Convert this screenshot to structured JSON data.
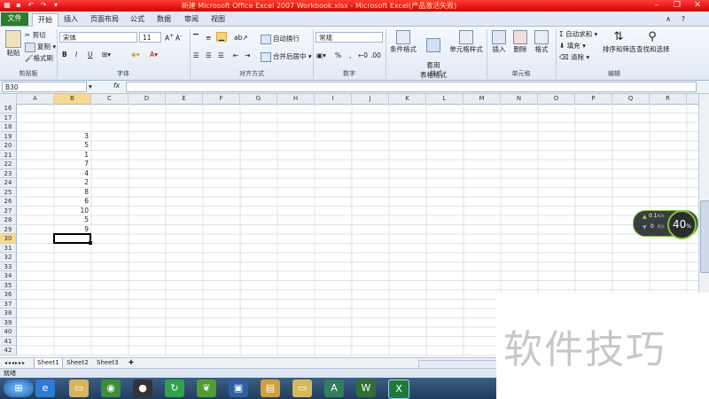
{
  "title": "新建 Microsoft Office Excel 2007 Workbook.xlsx - Microsoft Excel(产品激活失败)",
  "tabs": [
    "文件",
    "开始",
    "插入",
    "页面布局",
    "公式",
    "数据",
    "审阅",
    "视图"
  ],
  "active_tab": "开始",
  "clipboard": {
    "paste": "粘贴",
    "cut": "剪切",
    "copy": "复制",
    "format_painter": "格式刷",
    "group": "剪贴板"
  },
  "font": {
    "name": "宋体",
    "size": "11",
    "bold": "B",
    "italic": "I",
    "underline": "U",
    "group": "字体"
  },
  "alignment": {
    "wrap": "自动换行",
    "merge": "合并后居中",
    "group": "对齐方式"
  },
  "number": {
    "format": "常规",
    "percent": "%",
    "comma": ",",
    "group": "数字"
  },
  "styles": {
    "conditional": "条件格式",
    "table": "套用\n表格格式",
    "cell_styles": "单元格样式",
    "group": "样式"
  },
  "cells": {
    "insert": "插入",
    "delete": "删除",
    "format": "格式",
    "group": "单元格"
  },
  "editing": {
    "autosum": "自动求和",
    "fill": "填充",
    "clear": "清除",
    "sort_filter": "排序和筛选",
    "find_select": "查找和选择",
    "group": "编辑"
  },
  "namebox": "B30",
  "fx": "fx",
  "columns": [
    "A",
    "B",
    "C",
    "D",
    "E",
    "F",
    "G",
    "H",
    "I",
    "J",
    "K",
    "L",
    "M",
    "N",
    "O",
    "P",
    "Q",
    "R"
  ],
  "selected_col": "B",
  "rows": [
    "16",
    "17",
    "18",
    "19",
    "20",
    "21",
    "22",
    "23",
    "24",
    "25",
    "26",
    "27",
    "28",
    "29",
    "30",
    "31",
    "32",
    "33",
    "34",
    "35",
    "36",
    "37",
    "38",
    "39",
    "40",
    "41",
    "42"
  ],
  "selected_row": "30",
  "b_values": {
    "19": "3",
    "20": "5",
    "21": "1",
    "22": "7",
    "23": "4",
    "24": "2",
    "25": "8",
    "26": "6",
    "27": "10",
    "28": "5",
    "29": "9"
  },
  "sheets": [
    "Sheet1",
    "Sheet2",
    "Sheet3"
  ],
  "status": "就绪",
  "net": {
    "up": "0.1",
    "down": "0",
    "unit": "K/s",
    "percent": "40",
    "pct_sign": "%"
  },
  "watermark": "软件技巧",
  "colors": {
    "titlebar": "#d40000",
    "file_tab": "#2a7d2a",
    "selected_header": "#f9d98e"
  }
}
